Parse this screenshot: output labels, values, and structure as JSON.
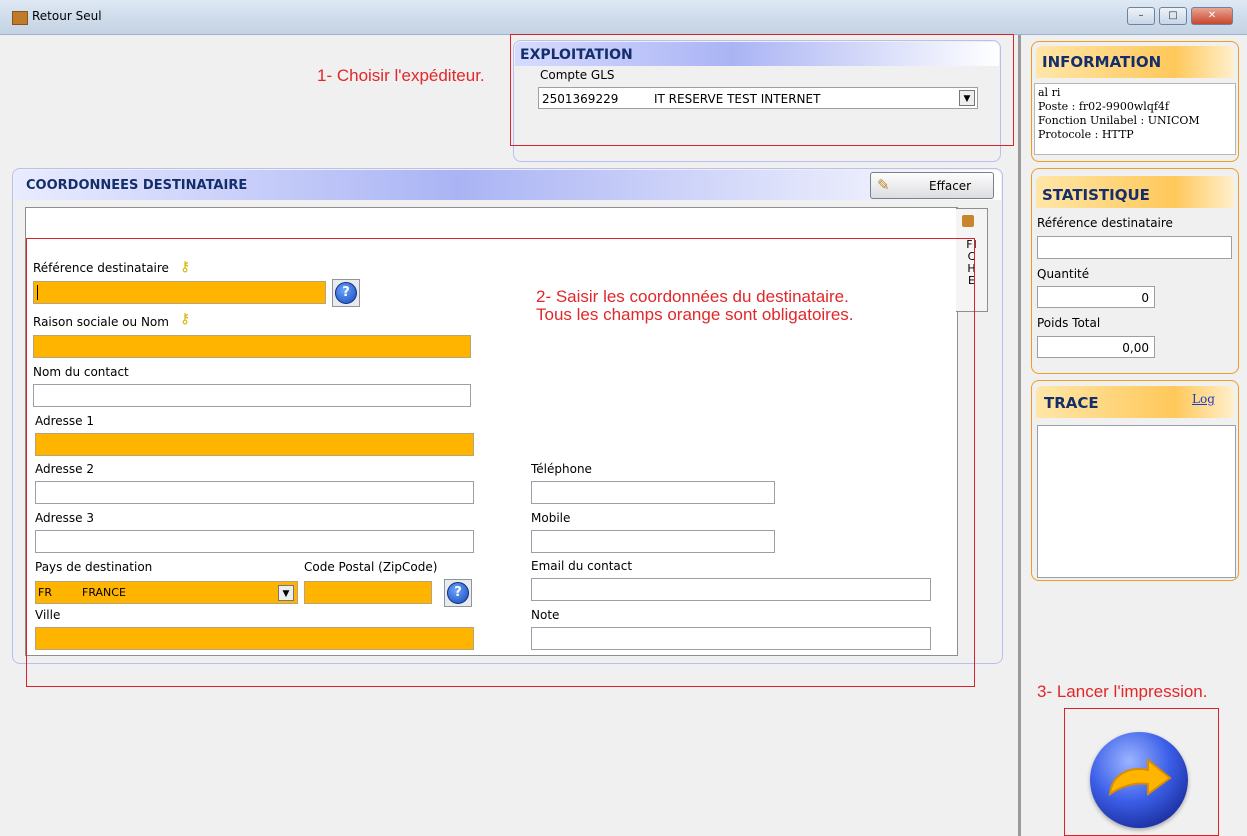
{
  "window": {
    "title": "Retour Seul",
    "minimize": "–",
    "maximize": "□",
    "close": "✕"
  },
  "exploitation": {
    "header": "EXPLOITATION",
    "account_label": "Compte GLS",
    "account_number": "2501369229",
    "account_name": "IT RESERVE TEST INTERNET"
  },
  "notes": {
    "step1": "1- Choisir l'expéditeur.",
    "step2_line1": "2- Saisir les coordonnées du destinataire.",
    "step2_line2": "Tous les champs orange sont obligatoires.",
    "step3": "3- Lancer l'impression."
  },
  "recipient": {
    "header": "COORDONNEES DESTINATAIRE",
    "clear_button": "Effacer",
    "tab_label": "FICHE",
    "reference_label": "Référence destinataire",
    "name_label": "Raison sociale ou Nom",
    "contact_label": "Nom du contact",
    "address1_label": "Adresse 1",
    "address2_label": "Adresse 2",
    "address3_label": "Adresse 3",
    "country_label": "Pays de destination",
    "country_code": "FR",
    "country_name": "FRANCE",
    "zip_label": "Code Postal (ZipCode)",
    "city_label": "Ville",
    "phone_label": "Téléphone",
    "mobile_label": "Mobile",
    "email_label": "Email du contact",
    "note_label": "Note",
    "help_glyph": "?"
  },
  "information": {
    "header": "INFORMATION",
    "lines": [
      "al ri",
      "Poste : fr02-9900wlqf4f",
      "Fonction Unilabel : UNICOM",
      "Protocole : HTTP"
    ]
  },
  "statistique": {
    "header": "STATISTIQUE",
    "reference_label": "Référence destinataire",
    "quantity_label": "Quantité",
    "quantity_value": "0",
    "weight_label": "Poids Total",
    "weight_value": "0,00"
  },
  "trace": {
    "header": "TRACE",
    "log_link": "Log"
  },
  "colors": {
    "required": "#ffb400",
    "accent": "#142d6b",
    "note": "#e0282a",
    "panel_border": "#ef9d24"
  }
}
